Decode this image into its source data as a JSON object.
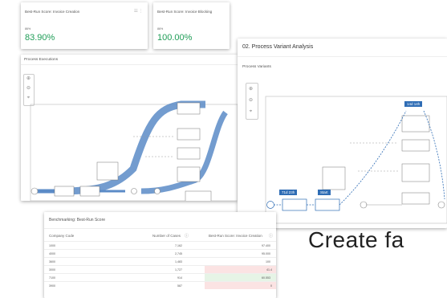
{
  "kpi_left": {
    "title": "Best-Run Score: Invoice Creation",
    "sub": "86%",
    "value": "83.90%"
  },
  "kpi_right": {
    "title": "Best-Run Score: Invoice Blocking",
    "sub": "86%",
    "value": "100.00%"
  },
  "process_executions": {
    "title": "Process Executions"
  },
  "variant": {
    "title": "02. Process Variant Analysis",
    "subtitle": "Process Variants",
    "badge_top": "14d 14h",
    "badge_left1": "71d 23h",
    "badge_left2": "Start"
  },
  "benchmark": {
    "title": "Benchmarking: Best-Run Score",
    "headers": [
      "Company Code",
      "Number of Cases",
      "Best-Run Score: Invoice Creation"
    ],
    "rows": [
      {
        "code": "1000",
        "cases": "7,162",
        "score": "97.400"
      },
      {
        "code": "4000",
        "cases": "2,745",
        "score": "95.000"
      },
      {
        "code": "3600",
        "cases": "1,483",
        "score": "100"
      },
      {
        "code": "3000",
        "cases": "1,727",
        "score": "41.4"
      },
      {
        "code": "7100",
        "cases": "914",
        "score": "60.553"
      },
      {
        "code": "3900",
        "cases": "587",
        "score": "0"
      }
    ]
  },
  "overlay_text": "Create fa",
  "colors": {
    "kpi_green": "#1f9d57",
    "flow_blue": "#4a7fbf",
    "badge_blue": "#2f6db5",
    "red_cell": "#fbe3e3",
    "green_cell": "#e6f4e6"
  }
}
